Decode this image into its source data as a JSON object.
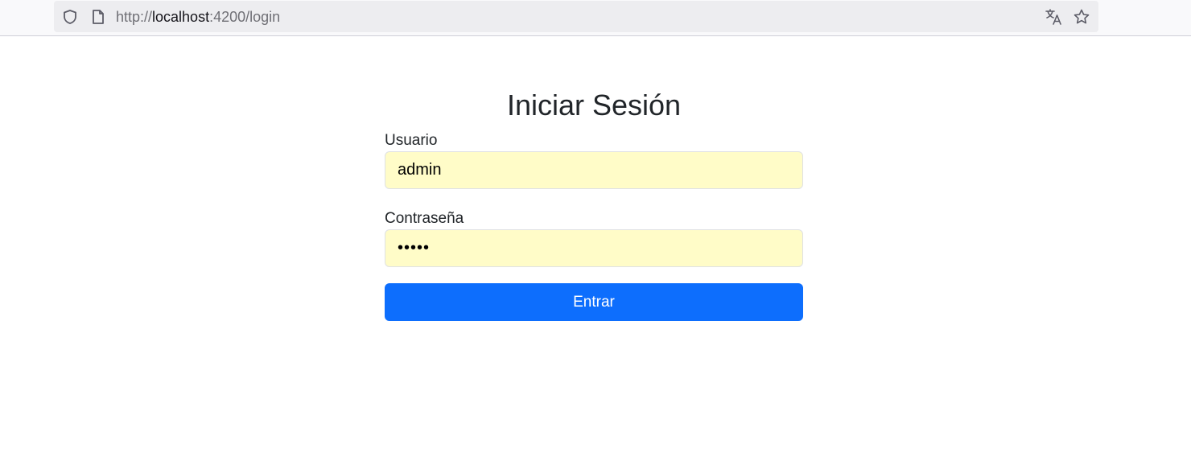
{
  "browser": {
    "url_scheme": "http://",
    "url_host": "localhost",
    "url_rest": ":4200/login",
    "icons": [
      "shield-icon",
      "page-icon",
      "translate-icon",
      "star-icon"
    ]
  },
  "login": {
    "title": "Iniciar Sesión",
    "username_label": "Usuario",
    "username_value": "admin",
    "password_label": "Contraseña",
    "password_value": "admin",
    "submit_label": "Entrar"
  },
  "colors": {
    "primary_button": "#0d6efd",
    "autofill_background": "#fffcc8",
    "text": "#212529"
  }
}
